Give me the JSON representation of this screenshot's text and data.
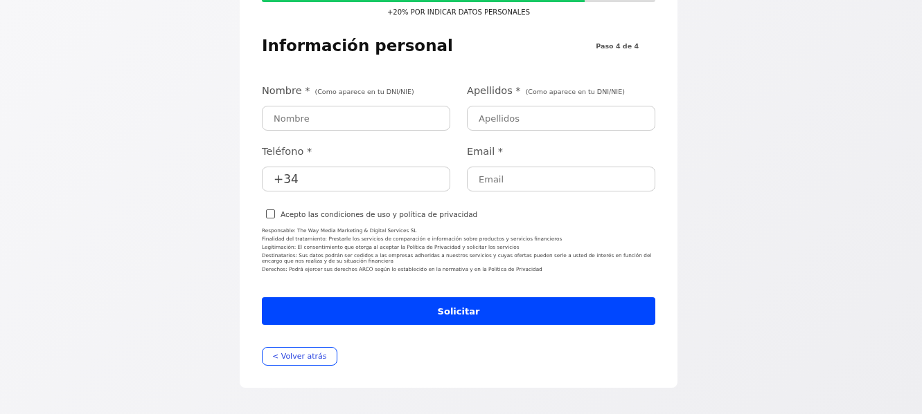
{
  "progress": {
    "level": 0.82,
    "caption": "+20% POR INDICAR DATOS PERSONALES"
  },
  "title": "Información personal",
  "step": "Paso 4 de 4",
  "fields": [
    {
      "label": "Nombre *",
      "hint": "(Como aparece en tu DNI/NIE)",
      "placeholder": "Nombre"
    },
    {
      "label": "Apellidos *",
      "hint": "(Como aparece en tu DNI/NIE)",
      "placeholder": "Apellidos"
    },
    {
      "label": "Teléfono *",
      "value": "+34"
    },
    {
      "label": "Email *",
      "placeholder": "Email"
    }
  ],
  "consent": {
    "label": "Acepto las condiciones de uso y política de privacidad",
    "checked": false
  },
  "legal": [
    "Responsable: The Way Media Marketing & Digital Services SL",
    "Finalidad del tratamiento: Prestarle los servicios de comparación e información sobre productos y servicios financieros",
    "Legitimación: El consentimiento que otorga al aceptar la Política de Privacidad y solicitar los servicios",
    "Destinatarios: Sus datos podrán ser cedidos a las empresas adheridas a nuestros servicios y cuyas ofertas pueden serle a usted de interés en función del encargo que nos realiza y de su situación financiera",
    "Derechos: Podrá ejercer sus derechos ARCO según lo establecido en la normativa y en la Política de Privacidad"
  ],
  "submit": "Solicitar",
  "back": "< Volver atrás"
}
